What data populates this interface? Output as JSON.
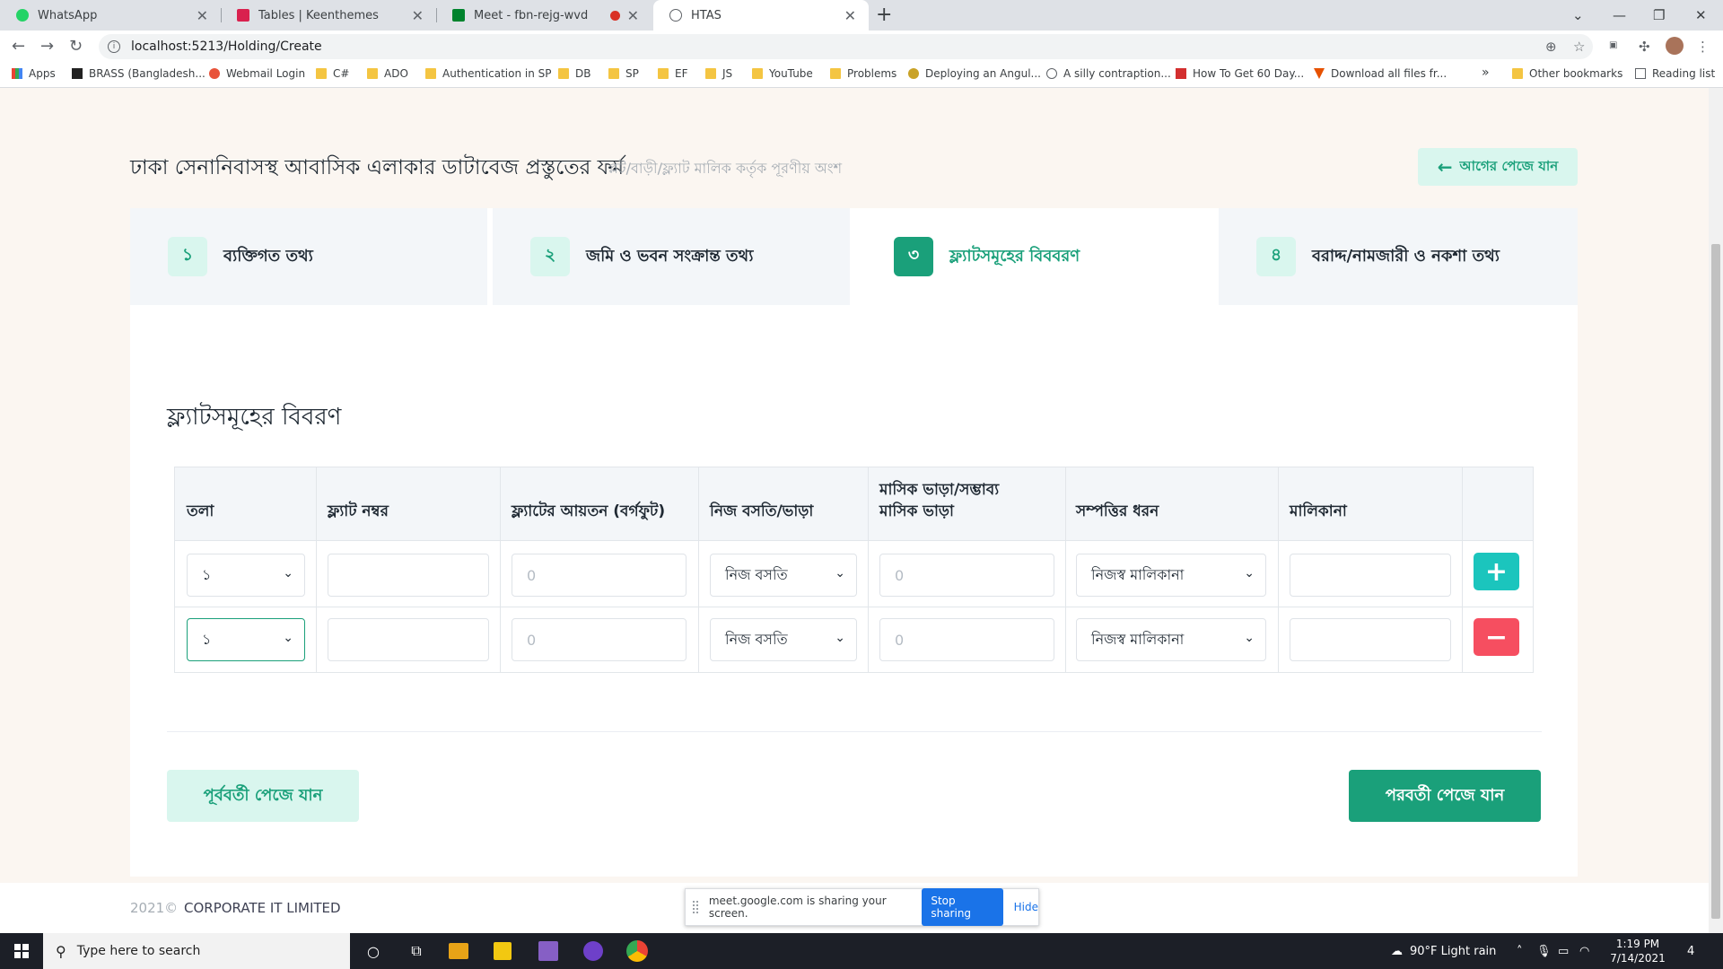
{
  "browser": {
    "tabs": [
      {
        "title": "WhatsApp",
        "favicon_color": "#25d366"
      },
      {
        "title": "Tables | Keenthemes",
        "favicon_color": "#d9214e"
      },
      {
        "title": "Meet - fbn-rejg-wvd",
        "favicon_color": "#00832d"
      },
      {
        "title": "HTAS",
        "favicon_color": "#5f6368"
      }
    ],
    "url": "localhost:5213/Holding/Create",
    "bookmarks": [
      "Apps",
      "BRASS (Bangladesh...",
      "Webmail Login",
      "C#",
      "ADO",
      "Authentication in SP",
      "DB",
      "SP",
      "EF",
      "JS",
      "YouTube",
      "Problems",
      "Deploying an Angul...",
      "A silly contraption...",
      "How To Get 60 Day...",
      "Download all files fr...",
      "Other bookmarks",
      "Reading list"
    ],
    "bookmark_overflow": "»"
  },
  "page": {
    "title": "ঢাকা সেনানিবাসস্থ আবাসিক এলাকার ডাটাবেজ প্রস্তুতের ফর্ম",
    "subtitle": "প্লট/বাড়ী/ফ্ল্যাট মালিক কর্তৃক পূরণীয় অংশ",
    "back_button": "আগের পেজে যান",
    "steps": [
      {
        "num": "১",
        "label": "ব্যক্তিগত তথ্য"
      },
      {
        "num": "২",
        "label": "জমি ও ভবন সংক্রান্ত তথ্য"
      },
      {
        "num": "৩",
        "label": "ফ্ল্যাটসমূহের বিববরণ"
      },
      {
        "num": "৪",
        "label": "বরাদ্দ/নামজারী ও নকশা তথ্য"
      }
    ],
    "active_step": 3,
    "section_title": "ফ্ল্যাটসমূহের বিবরণ",
    "table": {
      "headers": [
        "তলা",
        "ফ্ল্যাট নম্বর",
        "ফ্ল্যাটের আয়তন (বর্গফুট)",
        "নিজ বসতি/ভাড়া",
        "মাসিক ভাড়া/সম্ভাব্য মাসিক ভাড়া",
        "সম্পত্তির ধরন",
        "মালিকানা"
      ],
      "rows": [
        {
          "floor": "১",
          "flat_no": "",
          "area_placeholder": "0",
          "occupancy": "নিজ বসতি",
          "rent_placeholder": "0",
          "property_type": "নিজস্ব মালিকানা",
          "ownership": "",
          "action": "+"
        },
        {
          "floor": "১",
          "flat_no": "",
          "area_placeholder": "0",
          "occupancy": "নিজ বসতি",
          "rent_placeholder": "0",
          "property_type": "নিজস্ব মালিকানা",
          "ownership": "",
          "action": "−"
        }
      ]
    },
    "prev_button": "পূর্ববর্তী পেজে যান",
    "next_button": "পরবর্তী পেজে যান",
    "footer": {
      "year": "2021©",
      "company": "CORPORATE IT LIMITED"
    }
  },
  "share_bar": {
    "text": "meet.google.com is sharing your screen.",
    "stop": "Stop sharing",
    "hide": "Hide"
  },
  "taskbar": {
    "search_placeholder": "Type here to search",
    "weather": "90°F  Light rain",
    "time": "1:19 PM",
    "date": "7/14/2021",
    "notifications": "4"
  },
  "colors": {
    "accent": "#1aa07a",
    "accent_light": "#d9f6ee",
    "add_button": "#1bc5bd",
    "remove_button": "#f64e60"
  }
}
